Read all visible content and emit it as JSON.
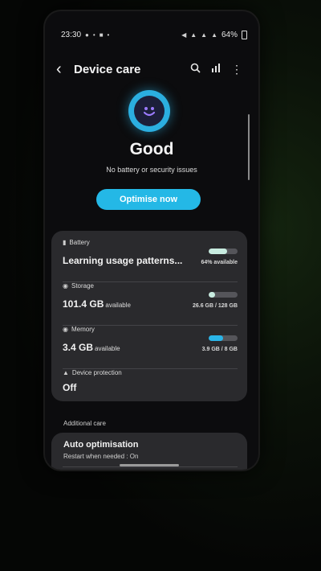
{
  "status_bar": {
    "time": "23:30",
    "left_icons": [
      "notification-icon",
      "nfc-icon",
      "message-icon",
      "dot-icon"
    ],
    "right_icons": [
      "alarm-icon",
      "wifi-icon",
      "signal-icon",
      "signal-icon"
    ],
    "battery_percent": "64%"
  },
  "header": {
    "title": "Device care",
    "actions": [
      "search-icon",
      "chart-icon",
      "more-icon"
    ]
  },
  "summary": {
    "status": "Good",
    "subtitle": "No battery or security issues",
    "optimise_label": "Optimise now",
    "face_color": "#2baee0"
  },
  "items": {
    "battery": {
      "label": "Battery",
      "value": "Learning usage patterns...",
      "detail": "64% available",
      "fill_fraction": 0.64,
      "fill_color": "#c8ece0"
    },
    "storage": {
      "label": "Storage",
      "value": "101.4 GB",
      "suffix": "available",
      "detail": "26.6 GB / 128 GB",
      "fill_fraction": 0.21,
      "fill_color": "#c8ece0"
    },
    "memory": {
      "label": "Memory",
      "value": "3.4 GB",
      "suffix": "available",
      "detail": "3.9 GB / 8 GB",
      "fill_fraction": 0.49,
      "fill_color": "#2ab5e8"
    },
    "protection": {
      "label": "Device protection",
      "value": "Off"
    }
  },
  "additional": {
    "header": "Additional care",
    "auto_opt_title": "Auto optimisation",
    "auto_opt_sub": "Restart when needed : On"
  }
}
